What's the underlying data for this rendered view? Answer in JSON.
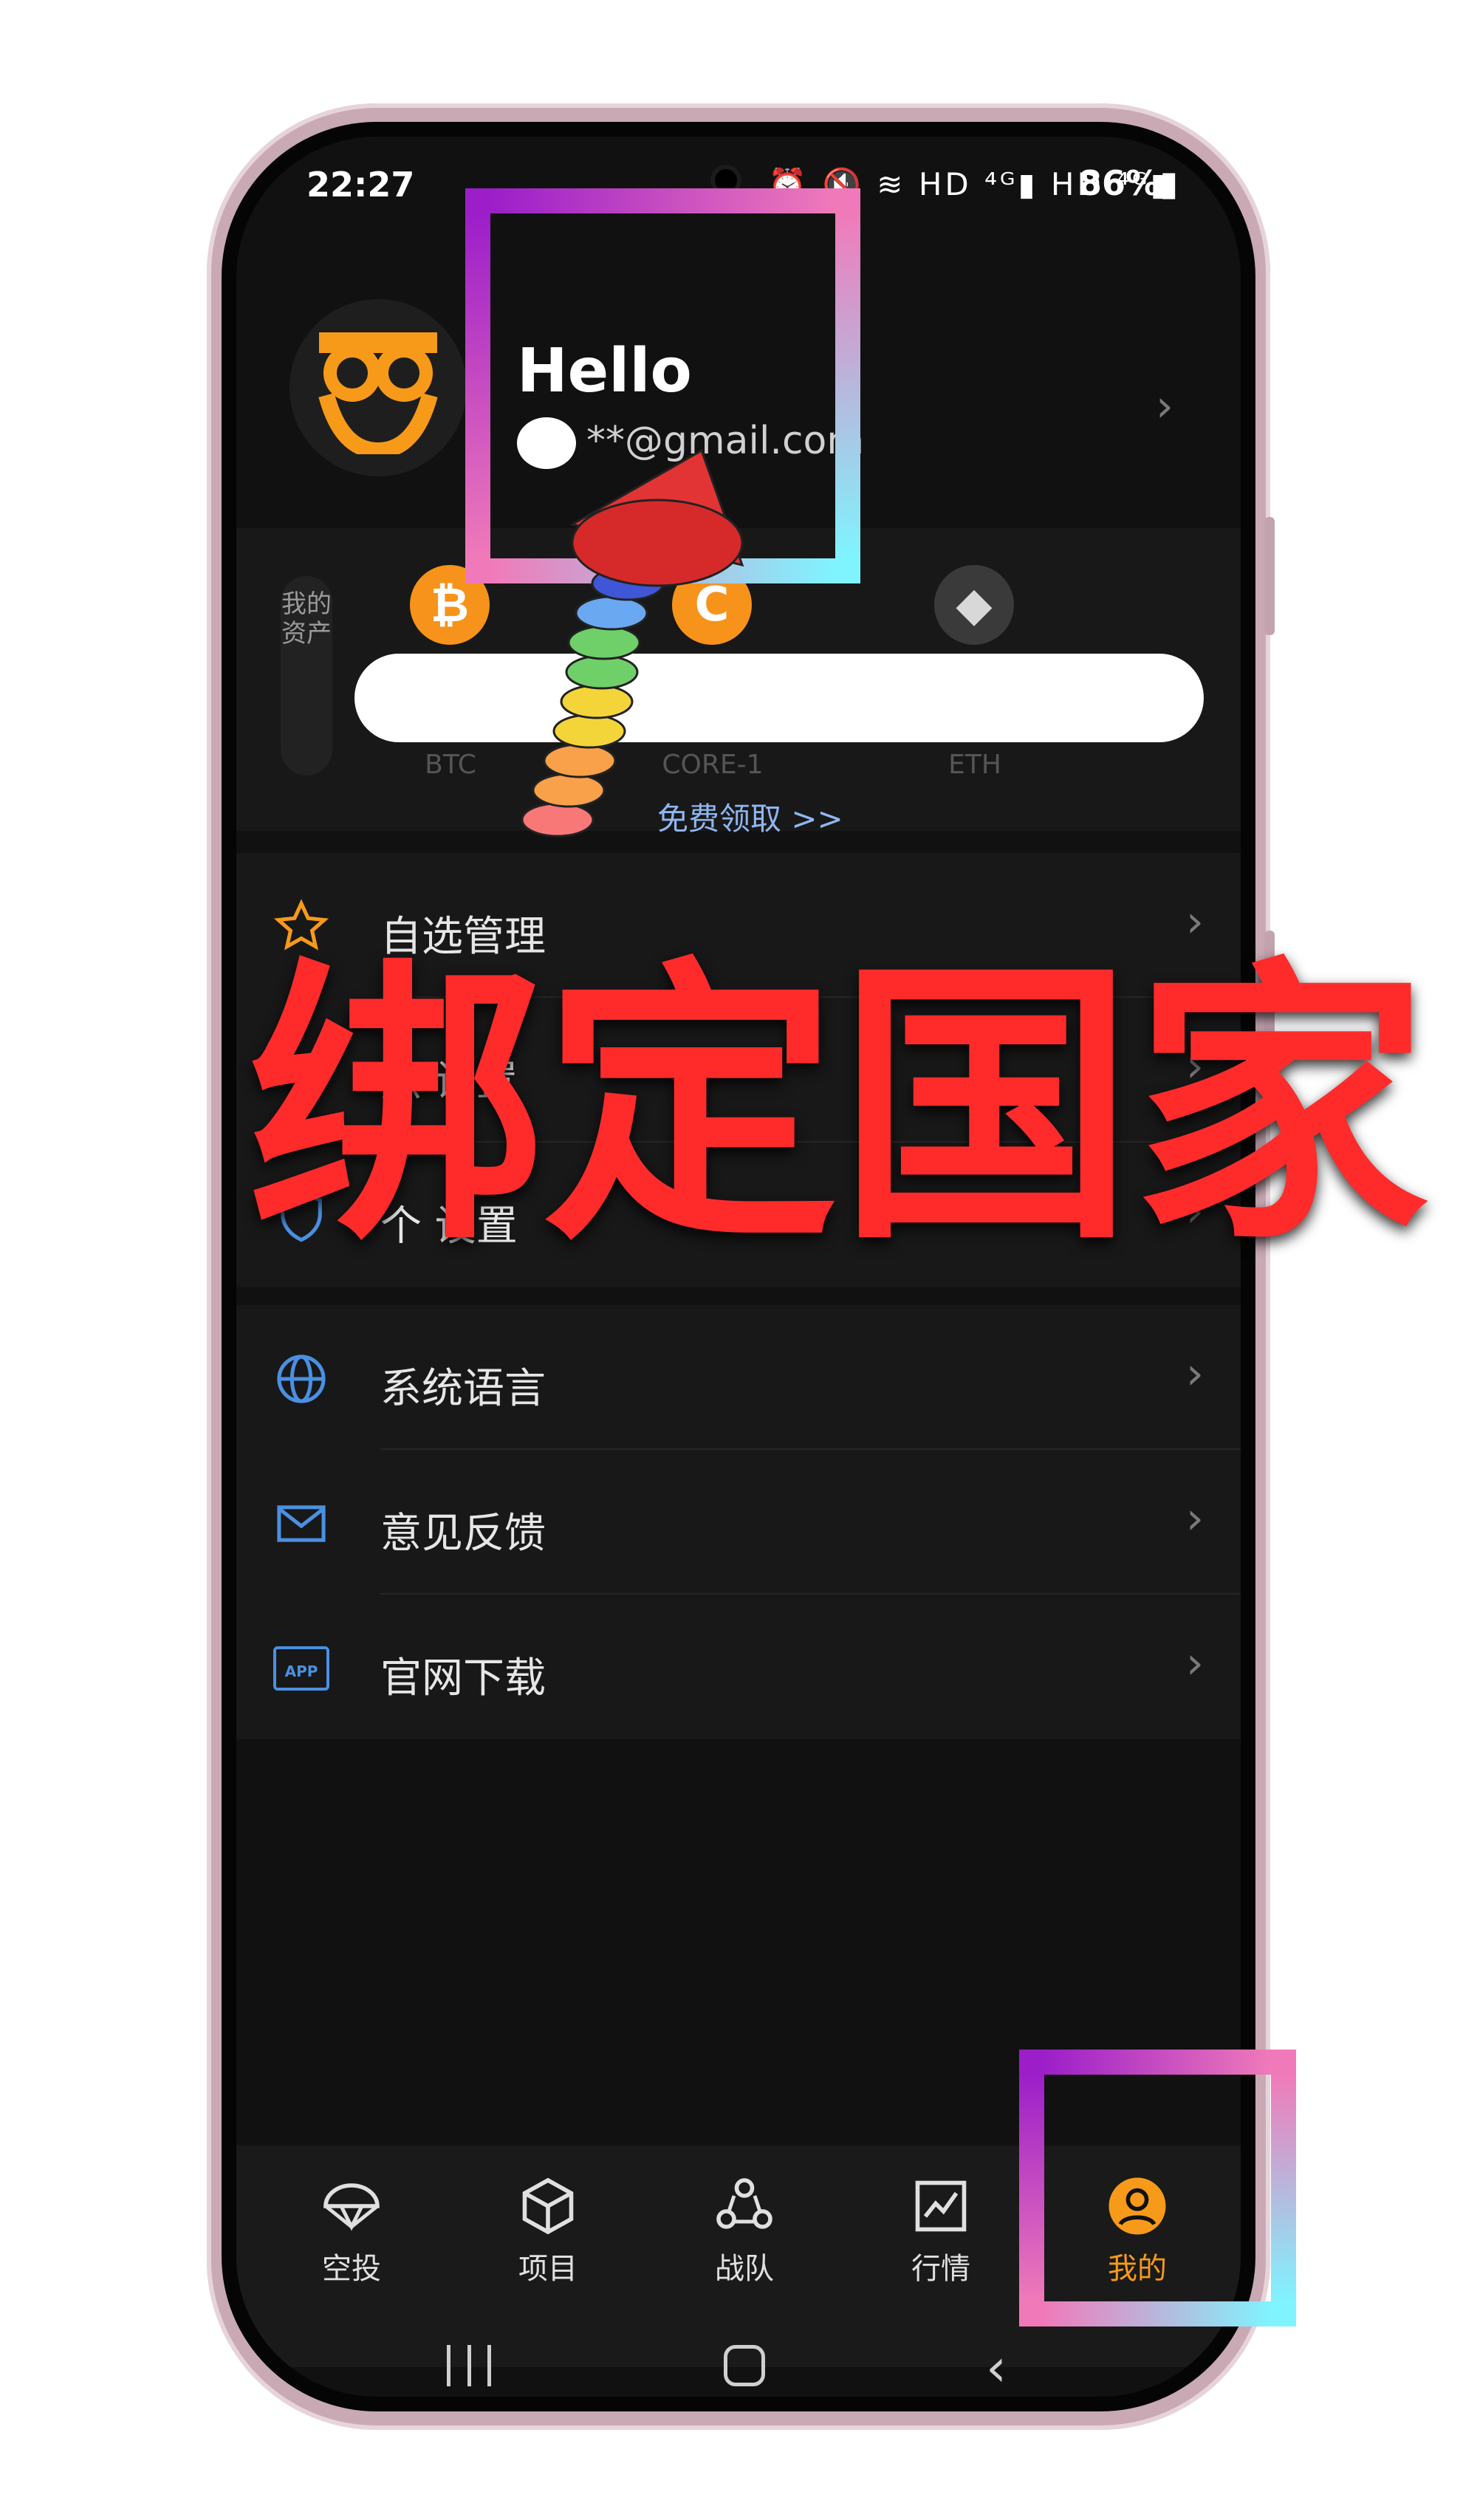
{
  "status": {
    "time": "22:27",
    "indicators": "⏰ 🔇 ≋ HD ⁴ᴳ▮ HD ⁴ᴳ▮",
    "battery": "86%▮"
  },
  "profile": {
    "greeting": "Hello",
    "email": "**@gmail.com"
  },
  "assets": {
    "tab_label": "我的资产",
    "coins": [
      {
        "symbol": "BTC",
        "glyph": "₿",
        "color": "#f7931a"
      },
      {
        "symbol": "CORE-1",
        "glyph": "C",
        "color": "#f7931a"
      },
      {
        "symbol": "ETH",
        "glyph": "◆",
        "color": "#3a3a3a"
      }
    ],
    "free_link": "免费领取 >>"
  },
  "menu": {
    "section1": [
      {
        "label": "自选管理",
        "icon": "star-icon"
      },
      {
        "label": "点 设置",
        "icon": "link-icon"
      },
      {
        "label": "个 设置",
        "icon": "shield-icon"
      }
    ],
    "section2": [
      {
        "label": "系统语言",
        "icon": "globe-icon"
      },
      {
        "label": "意见反馈",
        "icon": "mail-icon"
      },
      {
        "label": "官网下载",
        "icon": "app-icon"
      }
    ],
    "app_badge": "APP"
  },
  "tabs": [
    {
      "label": "空投",
      "icon": "parachute-icon"
    },
    {
      "label": "项目",
      "icon": "cube-icon"
    },
    {
      "label": "战队",
      "icon": "team-icon"
    },
    {
      "label": "行情",
      "icon": "chart-icon"
    },
    {
      "label": "我的",
      "icon": "user-icon"
    }
  ],
  "overlay": {
    "title": "绑定国家"
  },
  "colors": {
    "accent": "#f79a1a",
    "link": "#8fb6f0",
    "overlay": "#ff2b2b",
    "background": "#111111"
  }
}
